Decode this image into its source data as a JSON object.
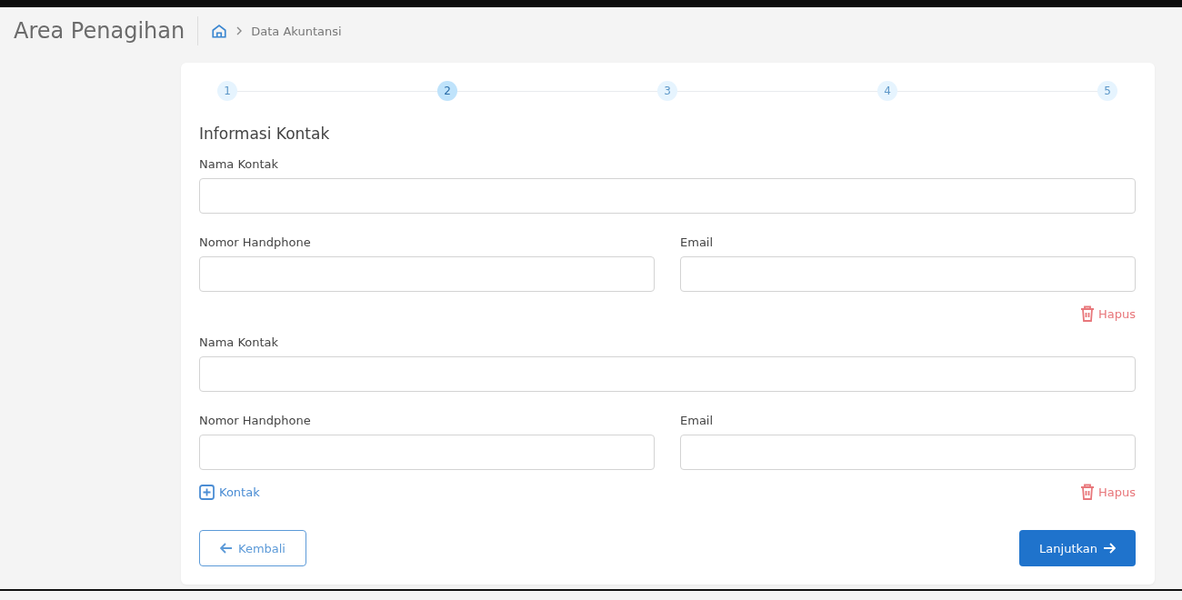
{
  "header": {
    "title": "Area Penagihan",
    "breadcrumb": "Data Akuntansi"
  },
  "steps": [
    {
      "label": "1",
      "selected": false
    },
    {
      "label": "2",
      "selected": true
    },
    {
      "label": "3",
      "selected": false
    },
    {
      "label": "4",
      "selected": false
    },
    {
      "label": "5",
      "selected": false
    }
  ],
  "section_title": "Informasi Kontak",
  "contacts": [
    {
      "name_label": "Nama Kontak",
      "phone_label": "Nomor Handphone",
      "email_label": "Email",
      "delete_label": "Hapus"
    },
    {
      "name_label": "Nama Kontak",
      "phone_label": "Nomor Handphone",
      "email_label": "Email",
      "delete_label": "Hapus"
    }
  ],
  "add_contact": "Kontak",
  "back_button": "Kembali",
  "next_button": "Lanjutkan"
}
